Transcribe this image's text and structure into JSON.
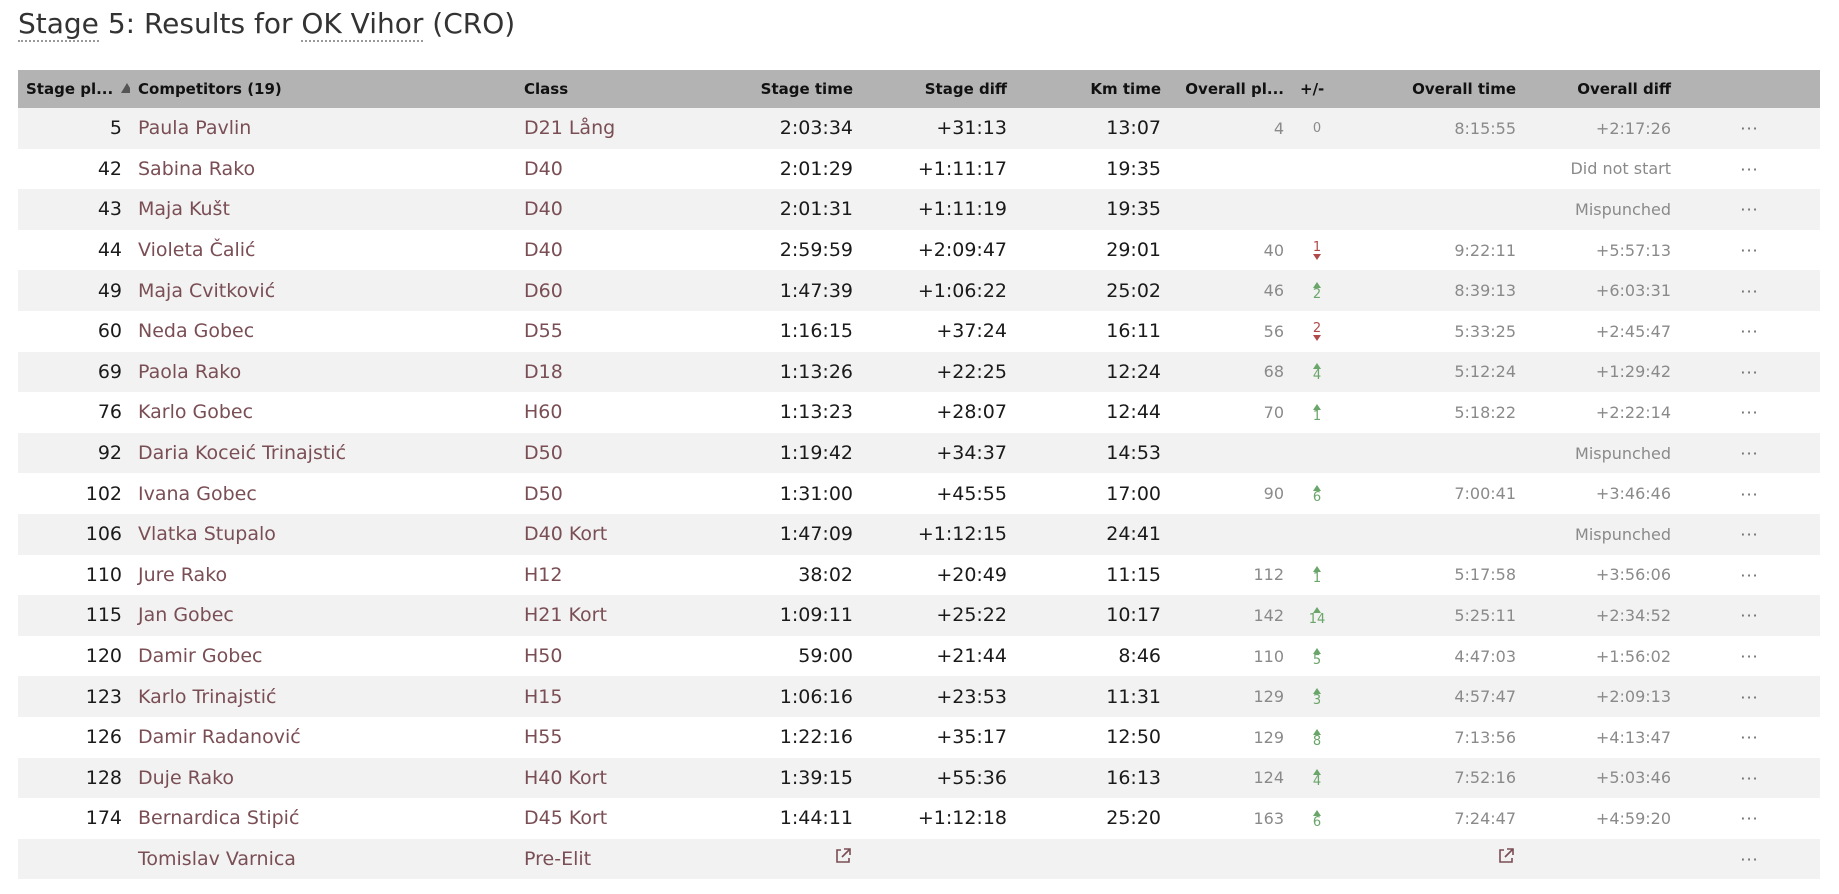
{
  "page_title": {
    "prefix": "Stage",
    "rest": " 5: Results for ",
    "club": "OK Vihor",
    "suffix": " (CRO)"
  },
  "columns": {
    "stage_place": "Stage pl...",
    "competitors": "Competitors (19)",
    "class": "Class",
    "stage_time": "Stage time",
    "stage_diff": "Stage diff",
    "km_time": "Km time",
    "overall_place": "Overall pl...",
    "plus_minus": "+/-",
    "overall_time": "Overall time",
    "overall_diff": "Overall diff"
  },
  "colors": {
    "header_bg": "#b3b3b3",
    "link": "#7a4e55",
    "up": "#6aa56a",
    "down": "#b04a4a",
    "muted": "#8a8a8a"
  },
  "rows": [
    {
      "place": "5",
      "name": "Paula Pavlin",
      "class": "D21 Lång",
      "stage_time": "2:03:34",
      "stage_diff": "+31:13",
      "km_time": "13:07",
      "overall_place": "4",
      "delta_dir": "same",
      "delta": "0",
      "overall_time": "8:15:55",
      "overall_diff": "+2:17:26"
    },
    {
      "place": "42",
      "name": "Sabina Rako",
      "class": "D40",
      "stage_time": "2:01:29",
      "stage_diff": "+1:11:17",
      "km_time": "19:35",
      "overall_place": "",
      "delta_dir": "",
      "delta": "",
      "overall_time": "",
      "overall_diff": "Did not start"
    },
    {
      "place": "43",
      "name": "Maja Kušt",
      "class": "D40",
      "stage_time": "2:01:31",
      "stage_diff": "+1:11:19",
      "km_time": "19:35",
      "overall_place": "",
      "delta_dir": "",
      "delta": "",
      "overall_time": "",
      "overall_diff": "Mispunched"
    },
    {
      "place": "44",
      "name": "Violeta Čalić",
      "class": "D40",
      "stage_time": "2:59:59",
      "stage_diff": "+2:09:47",
      "km_time": "29:01",
      "overall_place": "40",
      "delta_dir": "down",
      "delta": "1",
      "overall_time": "9:22:11",
      "overall_diff": "+5:57:13"
    },
    {
      "place": "49",
      "name": "Maja Cvitković",
      "class": "D60",
      "stage_time": "1:47:39",
      "stage_diff": "+1:06:22",
      "km_time": "25:02",
      "overall_place": "46",
      "delta_dir": "up",
      "delta": "2",
      "overall_time": "8:39:13",
      "overall_diff": "+6:03:31"
    },
    {
      "place": "60",
      "name": "Neda Gobec",
      "class": "D55",
      "stage_time": "1:16:15",
      "stage_diff": "+37:24",
      "km_time": "16:11",
      "overall_place": "56",
      "delta_dir": "down",
      "delta": "2",
      "overall_time": "5:33:25",
      "overall_diff": "+2:45:47"
    },
    {
      "place": "69",
      "name": "Paola Rako",
      "class": "D18",
      "stage_time": "1:13:26",
      "stage_diff": "+22:25",
      "km_time": "12:24",
      "overall_place": "68",
      "delta_dir": "up",
      "delta": "4",
      "overall_time": "5:12:24",
      "overall_diff": "+1:29:42"
    },
    {
      "place": "76",
      "name": "Karlo Gobec",
      "class": "H60",
      "stage_time": "1:13:23",
      "stage_diff": "+28:07",
      "km_time": "12:44",
      "overall_place": "70",
      "delta_dir": "up",
      "delta": "1",
      "overall_time": "5:18:22",
      "overall_diff": "+2:22:14"
    },
    {
      "place": "92",
      "name": "Daria Koceić Trinajstić",
      "class": "D50",
      "stage_time": "1:19:42",
      "stage_diff": "+34:37",
      "km_time": "14:53",
      "overall_place": "",
      "delta_dir": "",
      "delta": "",
      "overall_time": "",
      "overall_diff": "Mispunched"
    },
    {
      "place": "102",
      "name": "Ivana Gobec",
      "class": "D50",
      "stage_time": "1:31:00",
      "stage_diff": "+45:55",
      "km_time": "17:00",
      "overall_place": "90",
      "delta_dir": "up",
      "delta": "6",
      "overall_time": "7:00:41",
      "overall_diff": "+3:46:46"
    },
    {
      "place": "106",
      "name": "Vlatka Stupalo",
      "class": "D40 Kort",
      "stage_time": "1:47:09",
      "stage_diff": "+1:12:15",
      "km_time": "24:41",
      "overall_place": "",
      "delta_dir": "",
      "delta": "",
      "overall_time": "",
      "overall_diff": "Mispunched"
    },
    {
      "place": "110",
      "name": "Jure Rako",
      "class": "H12",
      "stage_time": "38:02",
      "stage_diff": "+20:49",
      "km_time": "11:15",
      "overall_place": "112",
      "delta_dir": "up",
      "delta": "1",
      "overall_time": "5:17:58",
      "overall_diff": "+3:56:06"
    },
    {
      "place": "115",
      "name": "Jan Gobec",
      "class": "H21 Kort",
      "stage_time": "1:09:11",
      "stage_diff": "+25:22",
      "km_time": "10:17",
      "overall_place": "142",
      "delta_dir": "up",
      "delta": "14",
      "overall_time": "5:25:11",
      "overall_diff": "+2:34:52"
    },
    {
      "place": "120",
      "name": "Damir Gobec",
      "class": "H50",
      "stage_time": "59:00",
      "stage_diff": "+21:44",
      "km_time": "8:46",
      "overall_place": "110",
      "delta_dir": "up",
      "delta": "5",
      "overall_time": "4:47:03",
      "overall_diff": "+1:56:02"
    },
    {
      "place": "123",
      "name": "Karlo Trinajstić",
      "class": "H15",
      "stage_time": "1:06:16",
      "stage_diff": "+23:53",
      "km_time": "11:31",
      "overall_place": "129",
      "delta_dir": "up",
      "delta": "3",
      "overall_time": "4:57:47",
      "overall_diff": "+2:09:13"
    },
    {
      "place": "126",
      "name": "Damir Radanović",
      "class": "H55",
      "stage_time": "1:22:16",
      "stage_diff": "+35:17",
      "km_time": "12:50",
      "overall_place": "129",
      "delta_dir": "up",
      "delta": "8",
      "overall_time": "7:13:56",
      "overall_diff": "+4:13:47"
    },
    {
      "place": "128",
      "name": "Duje Rako",
      "class": "H40 Kort",
      "stage_time": "1:39:15",
      "stage_diff": "+55:36",
      "km_time": "16:13",
      "overall_place": "124",
      "delta_dir": "up",
      "delta": "4",
      "overall_time": "7:52:16",
      "overall_diff": "+5:03:46"
    },
    {
      "place": "174",
      "name": "Bernardica Stipić",
      "class": "D45 Kort",
      "stage_time": "1:44:11",
      "stage_diff": "+1:12:18",
      "km_time": "25:20",
      "overall_place": "163",
      "delta_dir": "up",
      "delta": "6",
      "overall_time": "7:24:47",
      "overall_diff": "+4:59:20"
    },
    {
      "place": "",
      "name": "Tomislav Varnica",
      "class": "Pre-Elit",
      "stage_time_icon": "external-link-icon",
      "stage_diff": "",
      "km_time": "",
      "overall_place": "",
      "delta_dir": "",
      "delta": "",
      "overall_time_icon": "external-link-icon",
      "overall_diff": ""
    }
  ],
  "more_label": "···"
}
